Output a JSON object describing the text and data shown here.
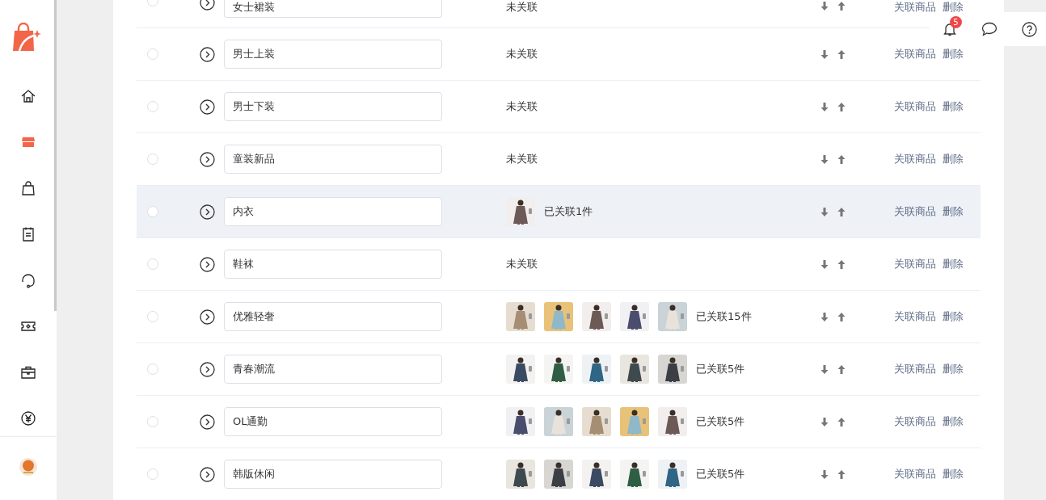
{
  "sidebar": {
    "items": [
      {
        "selected": false
      },
      {
        "selected": true
      },
      {
        "selected": false
      },
      {
        "selected": false
      },
      {
        "selected": false
      },
      {
        "selected": false
      },
      {
        "selected": false
      },
      {
        "selected": false
      }
    ]
  },
  "header": {
    "notification_count": "5"
  },
  "rows": [
    {
      "name": "女士裙装",
      "status": "未关联",
      "thumbnails": [],
      "highlighted": false,
      "checked": false,
      "link": "关联商品",
      "delete": "删除"
    },
    {
      "name": "男士上装",
      "status": "未关联",
      "thumbnails": [],
      "highlighted": false,
      "checked": false,
      "link": "关联商品",
      "delete": "删除"
    },
    {
      "name": "男士下装",
      "status": "未关联",
      "thumbnails": [],
      "highlighted": false,
      "checked": false,
      "link": "关联商品",
      "delete": "删除"
    },
    {
      "name": "童装新品",
      "status": "未关联",
      "thumbnails": [],
      "highlighted": false,
      "checked": false,
      "link": "关联商品",
      "delete": "删除"
    },
    {
      "name": "内衣",
      "status": "已关联1件",
      "highlighted": true,
      "checked": false,
      "link": "关联商品",
      "delete": "删除"
    },
    {
      "name": "鞋袜",
      "status": "未关联",
      "thumbnails": [],
      "highlighted": false,
      "checked": false,
      "link": "关联商品",
      "delete": "删除"
    },
    {
      "name": "优雅轻奢",
      "status": "已关联15件",
      "highlighted": false,
      "checked": false,
      "link": "关联商品",
      "delete": "删除"
    },
    {
      "name": "青春潮流",
      "status": "已关联5件",
      "highlighted": false,
      "checked": false,
      "link": "关联商品",
      "delete": "删除"
    },
    {
      "name": "OL通勤",
      "status": "已关联5件",
      "highlighted": false,
      "checked": false,
      "link": "关联商品",
      "delete": "删除"
    },
    {
      "name": "韩版休闲",
      "status": "已关联5件",
      "highlighted": false,
      "checked": false,
      "link": "关联商品",
      "delete": "删除"
    }
  ]
}
